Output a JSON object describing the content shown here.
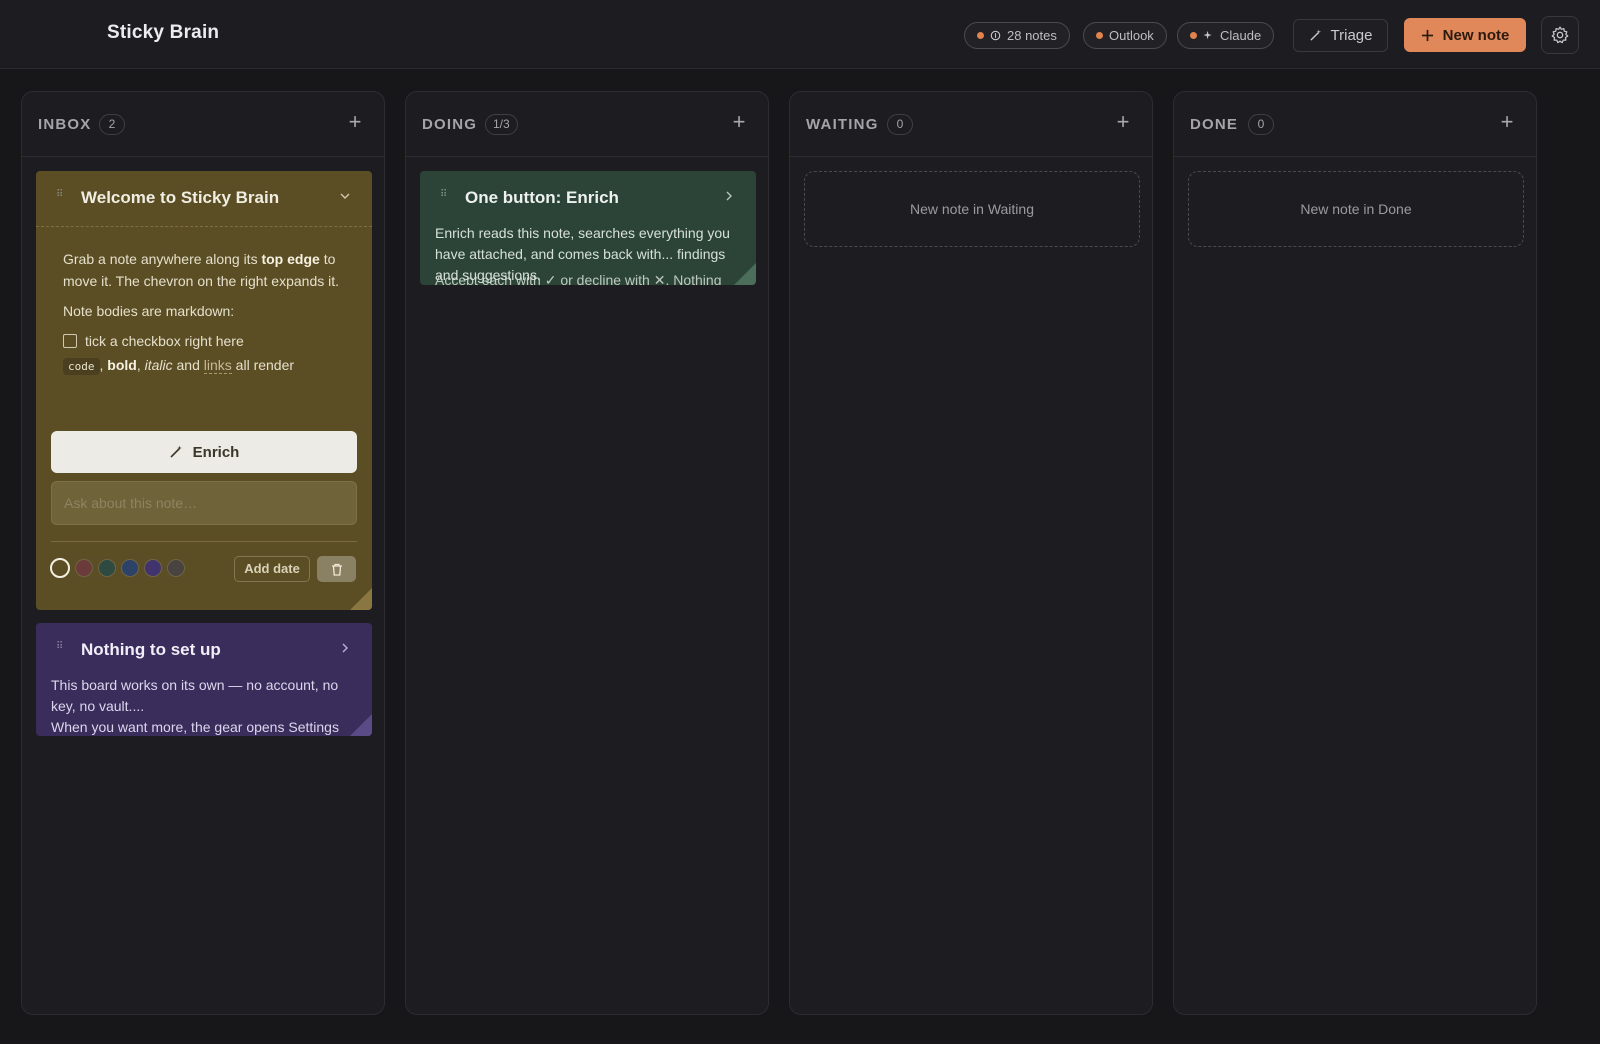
{
  "app": {
    "title": "Sticky Brain"
  },
  "header": {
    "pills": {
      "notes": "28 notes",
      "outlook": "Outlook",
      "claude": "Claude"
    },
    "triage_label": "Triage",
    "new_note_label": "New note"
  },
  "columns": [
    {
      "title": "INBOX",
      "count": "2"
    },
    {
      "title": "DOING",
      "count": "1/3"
    },
    {
      "title": "WAITING",
      "count": "0",
      "placeholder": "New note in Waiting"
    },
    {
      "title": "DONE",
      "count": "0",
      "placeholder": "New note in Done"
    }
  ],
  "notes": {
    "welcome": {
      "title": "Welcome to Sticky Brain",
      "p1_a": "Grab a note anywhere along its ",
      "p1_bold": "top edge",
      "p1_b": " to move it. The chevron on the right expands it.",
      "p2": "Note bodies are markdown:",
      "checkbox_label": "tick a checkbox right here",
      "md_code": "code",
      "md_sep1": ", ",
      "md_bold": "bold",
      "md_sep2": ", ",
      "md_italic": "italic",
      "md_and": " and ",
      "md_link": "links",
      "md_tail": " all render",
      "enrich_label": "Enrich",
      "ask_placeholder": "Ask about this note…",
      "add_date_label": "Add date",
      "color": "#5c4e24"
    },
    "setup": {
      "title": "Nothing to set up",
      "preview": "This board works on its own — no account, no key, no vault....",
      "preview2": "When you want more, the gear opens Settings",
      "color": "#3a2d5c"
    },
    "enrich": {
      "title": "One button: Enrich",
      "preview": "Enrich reads this note, searches everything you have attached, and comes back with... findings and suggestions.",
      "overlap": "Accept each with ✓ or decline with ✕. Nothing",
      "color": "#2b4437"
    }
  },
  "swatch_colors": [
    "#5c4e24",
    "#6b3a3a",
    "#2f4a40",
    "#2c4266",
    "#41336e",
    "#4a4440"
  ],
  "accent_color": "#e0885a"
}
